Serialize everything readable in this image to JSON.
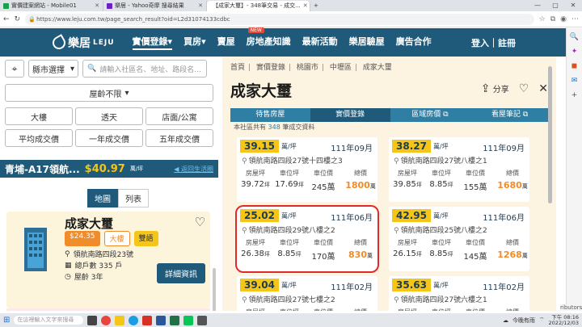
{
  "browser": {
    "tabs": [
      {
        "label": "實價建案網站 - Mobile01",
        "color": "#1a9f4a"
      },
      {
        "label": "樂居 - Yahoo奇摩 搜尋結果",
        "color": "#6b21c8"
      },
      {
        "label": "【成家大璽】- 348筆交易 - 成交...",
        "color": "#1f5a7a",
        "active": true
      }
    ],
    "url": "https://www.leju.com.tw/page_search_result?oid=L2d31074133cdbc",
    "window_controls": [
      "—",
      "▢",
      "✕"
    ]
  },
  "site": {
    "logo_text": "樂居",
    "logo_sub": "LEJU",
    "nav": [
      {
        "label": "實價登錄",
        "caret": "▾",
        "active": true
      },
      {
        "label": "買房",
        "caret": "▾"
      },
      {
        "label": "賣屋"
      },
      {
        "label": "房地產知識",
        "badge": "NEW"
      },
      {
        "label": "最新活動"
      },
      {
        "label": "樂居驗屋"
      },
      {
        "label": "廣告合作"
      }
    ],
    "auth": "登入｜註冊"
  },
  "left": {
    "county_select": "縣市選擇",
    "search_placeholder": "請輸入社區名、地址、路段名...",
    "price_select": "屋齡不限",
    "filters": [
      "大樓",
      "透天",
      "店面/公寓",
      "平均成交價",
      "一年成交價",
      "五年成交價"
    ],
    "listing": {
      "name": "青埔-A17領航...",
      "price": "$40.97",
      "unit": "萬/坪",
      "back": "返回生活圈"
    },
    "view_tabs": [
      "地圖",
      "列表"
    ],
    "building": {
      "name": "成家大璽",
      "price_tag": "$24.35",
      "tags": [
        "大樓",
        "雙語"
      ],
      "address": "領航南路四段23號",
      "units": "總戶數 335 戶",
      "age": "屋齡 3年",
      "detail_button": "詳細資訊"
    }
  },
  "right": {
    "breadcrumb": [
      "首頁",
      "實價登錄",
      "桃園市",
      "中壢區",
      "成家大璽"
    ],
    "title": "成家大璽",
    "share": "分享",
    "tabs": [
      "待售房屋",
      "實價登錄",
      "區域房價",
      "看屋筆記"
    ],
    "count_prefix": "本社區共有",
    "count_num": "348",
    "count_suffix": "筆成交資料",
    "col_labels": [
      "房屋坪",
      "車位坪",
      "車位價",
      "總價"
    ],
    "unit_ping": "坪",
    "unit_wan": "萬",
    "price_unit": "萬/坪",
    "deals": [
      {
        "price": "39.15",
        "date": "111年09月",
        "address": "領航南路四段27號十四樓之3",
        "house": "39.72",
        "park": "17.69",
        "park_price": "245萬",
        "total": "1800"
      },
      {
        "price": "38.27",
        "date": "111年09月",
        "address": "領航南路四段27號八樓之1",
        "house": "39.85",
        "park": "8.85",
        "park_price": "155萬",
        "total": "1680"
      },
      {
        "price": "25.02",
        "date": "111年06月",
        "address": "領航南路四段29號八樓之2",
        "house": "26.38",
        "park": "8.85",
        "park_price": "170萬",
        "total": "830",
        "highlight": true
      },
      {
        "price": "42.95",
        "date": "111年06月",
        "address": "領航南路四段25號八樓之2",
        "house": "26.15",
        "park": "8.85",
        "park_price": "145萬",
        "total": "1268"
      },
      {
        "price": "39.04",
        "date": "111年02月",
        "address": "領航南路四段27號七樓之2",
        "house": "",
        "park": "",
        "park_price": "",
        "total": ""
      },
      {
        "price": "35.63",
        "date": "111年02月",
        "address": "領航南路四段27號六樓之1",
        "house": "",
        "park": "",
        "park_price": "",
        "total": ""
      }
    ]
  },
  "edge_label": "ributors",
  "taskbar": {
    "search_placeholder": "在這裡輸入文字來搜尋",
    "weather": "今晚有雨",
    "time": "下午 08:16",
    "date": "2022/12/03"
  }
}
